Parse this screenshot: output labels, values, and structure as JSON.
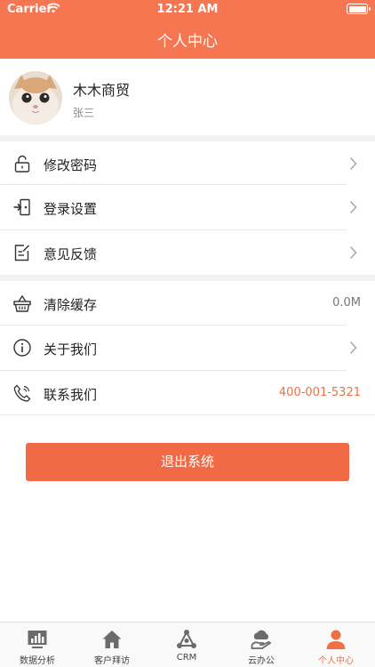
{
  "status_bar": {
    "carrier": "Carrier",
    "time": "12:21 AM"
  },
  "nav": {
    "title": "个人中心"
  },
  "profile": {
    "company": "木木商贸",
    "user": "张三"
  },
  "menu": {
    "change_password": {
      "label": "修改密码",
      "icon": "unlock-icon"
    },
    "login_settings": {
      "label": "登录设置",
      "icon": "login-door-icon"
    },
    "feedback": {
      "label": "意见反馈",
      "icon": "feedback-edit-icon"
    },
    "clear_cache": {
      "label": "清除缓存",
      "icon": "basket-icon",
      "value": "0.0M"
    },
    "about": {
      "label": "关于我们",
      "icon": "info-icon"
    },
    "contact": {
      "label": "联系我们",
      "icon": "phone-icon",
      "value": "400-001-5321"
    }
  },
  "logout": {
    "label": "退出系统"
  },
  "tabbar": {
    "items": [
      {
        "label": "数据分析",
        "icon": "chart-icon"
      },
      {
        "label": "客户拜访",
        "icon": "home-icon"
      },
      {
        "label": "CRM",
        "icon": "crm-icon"
      },
      {
        "label": "云办公",
        "icon": "cloud-office-icon"
      },
      {
        "label": "个人中心",
        "icon": "person-icon"
      }
    ],
    "active_index": 4
  },
  "colors": {
    "accent": "#f57651",
    "button": "#ef6a45",
    "phone_text": "#f07045"
  }
}
